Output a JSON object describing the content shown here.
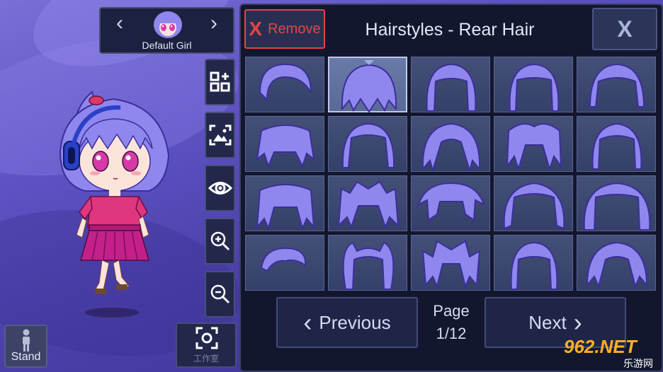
{
  "colors": {
    "accent_red": "#e24545",
    "panel_dark": "#13172e",
    "cell": "#3f4a74",
    "hair": "#8f86ee",
    "skin": "#fde4db",
    "shirt": "#e0367f"
  },
  "character_selector": {
    "name": "Default Girl",
    "prev_icon": "chevron-left-icon",
    "next_icon": "chevron-right-icon"
  },
  "side_tools": [
    {
      "name": "qr-add-icon"
    },
    {
      "name": "background-image-icon"
    },
    {
      "name": "eye-icon"
    },
    {
      "name": "zoom-in-icon"
    },
    {
      "name": "zoom-out-icon"
    }
  ],
  "bottom_left": {
    "stand_label": "Stand",
    "studio_label": "工作室"
  },
  "panel": {
    "remove_mark": "X",
    "remove_label": "Remove",
    "title": "Hairstyles - Rear Hair",
    "close_mark": "X"
  },
  "hairstyles": {
    "selected_index": 1,
    "count": 20
  },
  "pagination": {
    "previous_label": "Previous",
    "next_label": "Next",
    "page_label": "Page",
    "page_value": "1/12"
  },
  "watermark": {
    "text": "962.NET",
    "subtext": "乐游网"
  }
}
